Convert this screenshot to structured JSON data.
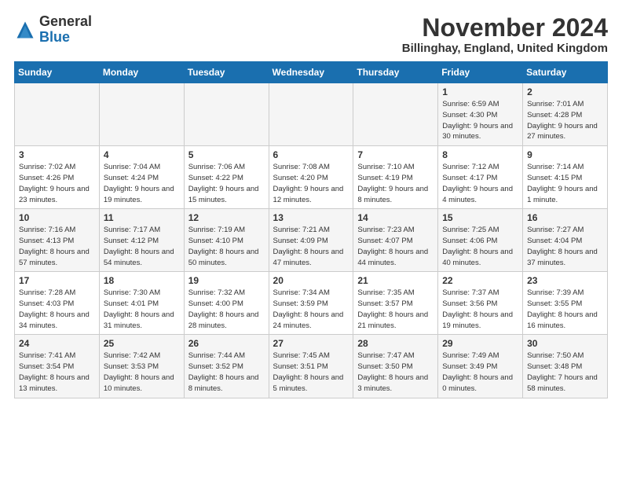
{
  "header": {
    "logo_general": "General",
    "logo_blue": "Blue",
    "month_title": "November 2024",
    "location": "Billinghay, England, United Kingdom"
  },
  "days_of_week": [
    "Sunday",
    "Monday",
    "Tuesday",
    "Wednesday",
    "Thursday",
    "Friday",
    "Saturday"
  ],
  "weeks": [
    [
      {
        "day": "",
        "info": ""
      },
      {
        "day": "",
        "info": ""
      },
      {
        "day": "",
        "info": ""
      },
      {
        "day": "",
        "info": ""
      },
      {
        "day": "",
        "info": ""
      },
      {
        "day": "1",
        "info": "Sunrise: 6:59 AM\nSunset: 4:30 PM\nDaylight: 9 hours\nand 30 minutes."
      },
      {
        "day": "2",
        "info": "Sunrise: 7:01 AM\nSunset: 4:28 PM\nDaylight: 9 hours\nand 27 minutes."
      }
    ],
    [
      {
        "day": "3",
        "info": "Sunrise: 7:02 AM\nSunset: 4:26 PM\nDaylight: 9 hours\nand 23 minutes."
      },
      {
        "day": "4",
        "info": "Sunrise: 7:04 AM\nSunset: 4:24 PM\nDaylight: 9 hours\nand 19 minutes."
      },
      {
        "day": "5",
        "info": "Sunrise: 7:06 AM\nSunset: 4:22 PM\nDaylight: 9 hours\nand 15 minutes."
      },
      {
        "day": "6",
        "info": "Sunrise: 7:08 AM\nSunset: 4:20 PM\nDaylight: 9 hours\nand 12 minutes."
      },
      {
        "day": "7",
        "info": "Sunrise: 7:10 AM\nSunset: 4:19 PM\nDaylight: 9 hours\nand 8 minutes."
      },
      {
        "day": "8",
        "info": "Sunrise: 7:12 AM\nSunset: 4:17 PM\nDaylight: 9 hours\nand 4 minutes."
      },
      {
        "day": "9",
        "info": "Sunrise: 7:14 AM\nSunset: 4:15 PM\nDaylight: 9 hours\nand 1 minute."
      }
    ],
    [
      {
        "day": "10",
        "info": "Sunrise: 7:16 AM\nSunset: 4:13 PM\nDaylight: 8 hours\nand 57 minutes."
      },
      {
        "day": "11",
        "info": "Sunrise: 7:17 AM\nSunset: 4:12 PM\nDaylight: 8 hours\nand 54 minutes."
      },
      {
        "day": "12",
        "info": "Sunrise: 7:19 AM\nSunset: 4:10 PM\nDaylight: 8 hours\nand 50 minutes."
      },
      {
        "day": "13",
        "info": "Sunrise: 7:21 AM\nSunset: 4:09 PM\nDaylight: 8 hours\nand 47 minutes."
      },
      {
        "day": "14",
        "info": "Sunrise: 7:23 AM\nSunset: 4:07 PM\nDaylight: 8 hours\nand 44 minutes."
      },
      {
        "day": "15",
        "info": "Sunrise: 7:25 AM\nSunset: 4:06 PM\nDaylight: 8 hours\nand 40 minutes."
      },
      {
        "day": "16",
        "info": "Sunrise: 7:27 AM\nSunset: 4:04 PM\nDaylight: 8 hours\nand 37 minutes."
      }
    ],
    [
      {
        "day": "17",
        "info": "Sunrise: 7:28 AM\nSunset: 4:03 PM\nDaylight: 8 hours\nand 34 minutes."
      },
      {
        "day": "18",
        "info": "Sunrise: 7:30 AM\nSunset: 4:01 PM\nDaylight: 8 hours\nand 31 minutes."
      },
      {
        "day": "19",
        "info": "Sunrise: 7:32 AM\nSunset: 4:00 PM\nDaylight: 8 hours\nand 28 minutes."
      },
      {
        "day": "20",
        "info": "Sunrise: 7:34 AM\nSunset: 3:59 PM\nDaylight: 8 hours\nand 24 minutes."
      },
      {
        "day": "21",
        "info": "Sunrise: 7:35 AM\nSunset: 3:57 PM\nDaylight: 8 hours\nand 21 minutes."
      },
      {
        "day": "22",
        "info": "Sunrise: 7:37 AM\nSunset: 3:56 PM\nDaylight: 8 hours\nand 19 minutes."
      },
      {
        "day": "23",
        "info": "Sunrise: 7:39 AM\nSunset: 3:55 PM\nDaylight: 8 hours\nand 16 minutes."
      }
    ],
    [
      {
        "day": "24",
        "info": "Sunrise: 7:41 AM\nSunset: 3:54 PM\nDaylight: 8 hours\nand 13 minutes."
      },
      {
        "day": "25",
        "info": "Sunrise: 7:42 AM\nSunset: 3:53 PM\nDaylight: 8 hours\nand 10 minutes."
      },
      {
        "day": "26",
        "info": "Sunrise: 7:44 AM\nSunset: 3:52 PM\nDaylight: 8 hours\nand 8 minutes."
      },
      {
        "day": "27",
        "info": "Sunrise: 7:45 AM\nSunset: 3:51 PM\nDaylight: 8 hours\nand 5 minutes."
      },
      {
        "day": "28",
        "info": "Sunrise: 7:47 AM\nSunset: 3:50 PM\nDaylight: 8 hours\nand 3 minutes."
      },
      {
        "day": "29",
        "info": "Sunrise: 7:49 AM\nSunset: 3:49 PM\nDaylight: 8 hours\nand 0 minutes."
      },
      {
        "day": "30",
        "info": "Sunrise: 7:50 AM\nSunset: 3:48 PM\nDaylight: 7 hours\nand 58 minutes."
      }
    ]
  ]
}
